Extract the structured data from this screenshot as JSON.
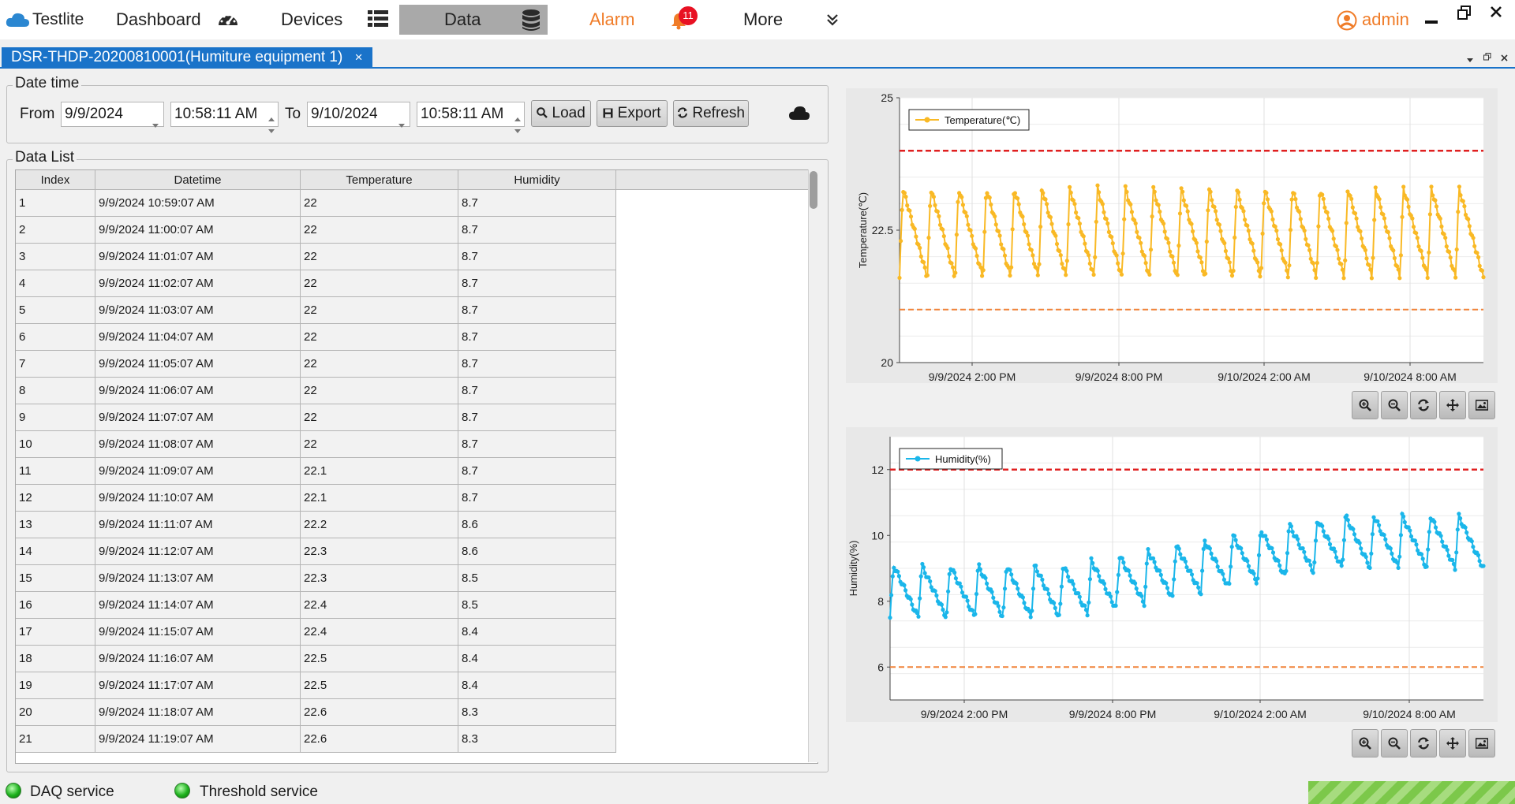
{
  "app": {
    "title": "Testlite"
  },
  "nav": {
    "dashboard": "Dashboard",
    "devices": "Devices",
    "data": "Data",
    "alarm": "Alarm",
    "alarm_badge": "11",
    "more": "More",
    "user": "admin",
    "colors": {
      "alarm": "#f07c28",
      "active_bg": "#a9a9a9",
      "badge": "#e81123",
      "user": "#f07c28"
    }
  },
  "doc_tab": {
    "title": "DSR-THDP-20200810001(Humiture equipment 1)",
    "close": "×"
  },
  "date_time": {
    "group_title": "Date time",
    "from_label": "From",
    "from_date": "9/9/2024",
    "from_time": "10:58:11 AM",
    "to_label": "To",
    "to_date": "9/10/2024",
    "to_time": "10:58:11 AM",
    "load": "Load",
    "export": "Export",
    "refresh": "Refresh"
  },
  "data_list": {
    "group_title": "Data List",
    "columns": [
      "Index",
      "Datetime",
      "Temperature",
      "Humidity"
    ],
    "rows": [
      [
        "1",
        "9/9/2024 10:59:07 AM",
        "22",
        "8.7"
      ],
      [
        "2",
        "9/9/2024 11:00:07 AM",
        "22",
        "8.7"
      ],
      [
        "3",
        "9/9/2024 11:01:07 AM",
        "22",
        "8.7"
      ],
      [
        "4",
        "9/9/2024 11:02:07 AM",
        "22",
        "8.7"
      ],
      [
        "5",
        "9/9/2024 11:03:07 AM",
        "22",
        "8.7"
      ],
      [
        "6",
        "9/9/2024 11:04:07 AM",
        "22",
        "8.7"
      ],
      [
        "7",
        "9/9/2024 11:05:07 AM",
        "22",
        "8.7"
      ],
      [
        "8",
        "9/9/2024 11:06:07 AM",
        "22",
        "8.7"
      ],
      [
        "9",
        "9/9/2024 11:07:07 AM",
        "22",
        "8.7"
      ],
      [
        "10",
        "9/9/2024 11:08:07 AM",
        "22",
        "8.7"
      ],
      [
        "11",
        "9/9/2024 11:09:07 AM",
        "22.1",
        "8.7"
      ],
      [
        "12",
        "9/9/2024 11:10:07 AM",
        "22.1",
        "8.7"
      ],
      [
        "13",
        "9/9/2024 11:11:07 AM",
        "22.2",
        "8.6"
      ],
      [
        "14",
        "9/9/2024 11:12:07 AM",
        "22.3",
        "8.6"
      ],
      [
        "15",
        "9/9/2024 11:13:07 AM",
        "22.3",
        "8.5"
      ],
      [
        "16",
        "9/9/2024 11:14:07 AM",
        "22.4",
        "8.5"
      ],
      [
        "17",
        "9/9/2024 11:15:07 AM",
        "22.4",
        "8.4"
      ],
      [
        "18",
        "9/9/2024 11:16:07 AM",
        "22.5",
        "8.4"
      ],
      [
        "19",
        "9/9/2024 11:17:07 AM",
        "22.5",
        "8.4"
      ],
      [
        "20",
        "9/9/2024 11:18:07 AM",
        "22.6",
        "8.3"
      ],
      [
        "21",
        "9/9/2024 11:19:07 AM",
        "22.6",
        "8.3"
      ]
    ]
  },
  "chart_data": [
    {
      "type": "line",
      "legend": "Temperature(℃)",
      "ylabel": "Temperature(℃)",
      "xlabel": "",
      "ylim": [
        20,
        25
      ],
      "yticks": [
        "25",
        "22.5",
        "20"
      ],
      "xticks": [
        "9/9/2024 2:00 PM",
        "9/9/2024 8:00 PM",
        "9/10/2024 2:00 AM",
        "9/10/2024 8:00 AM"
      ],
      "upper_limit": 24,
      "lower_limit": 21,
      "series_color": "#f9b925",
      "upper_color": "#e02020",
      "lower_color": "#f0843a",
      "baseline_min": 21.6,
      "peak_max": 23.3,
      "cycles": 21
    },
    {
      "type": "line",
      "legend": "Humidity(%)",
      "ylabel": "Humidity(%)",
      "xlabel": "",
      "ylim": [
        5,
        13
      ],
      "yticks": [
        "12",
        "10",
        "8",
        "6"
      ],
      "xticks": [
        "9/9/2024 2:00 PM",
        "9/9/2024 8:00 PM",
        "9/10/2024 2:00 AM",
        "9/10/2024 8:00 AM"
      ],
      "upper_limit": 12,
      "lower_limit": 6,
      "series_color": "#1ab6ea",
      "upper_color": "#e02020",
      "lower_color": "#f0843a",
      "start_level": 8.3,
      "end_level": 9.8,
      "cycles": 21
    }
  ],
  "status": {
    "daq": "DAQ service",
    "threshold": "Threshold service",
    "led_color": "#1db11d"
  }
}
